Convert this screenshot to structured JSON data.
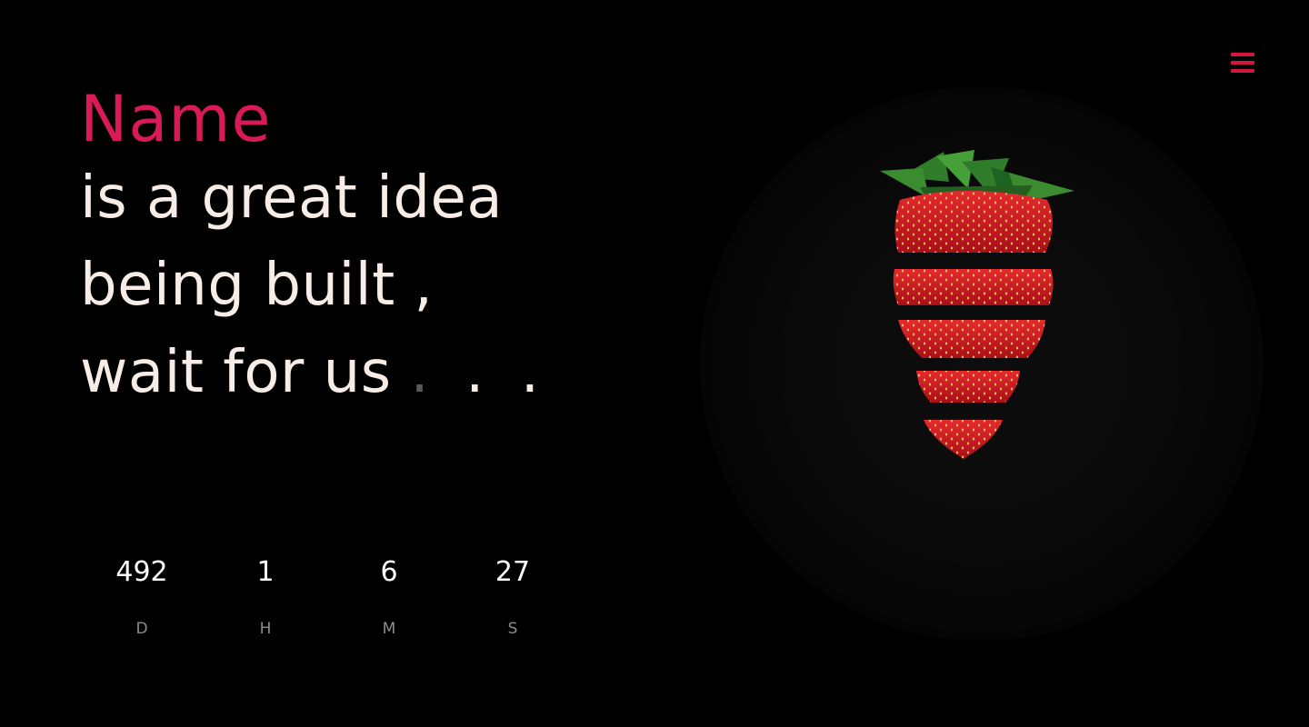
{
  "header": {
    "menu_icon": "hamburger-menu-icon",
    "accent_color": "#d1163f"
  },
  "headline": {
    "brand": "Name",
    "line1": "is a great idea",
    "line2": "being built ,",
    "line3_text": "wait for us",
    "ellipsis": [
      ". ",
      ". ",
      "."
    ],
    "brand_color": "#d81b56",
    "text_color": "#f7ece6"
  },
  "countdown": {
    "days": {
      "value": "492",
      "label": "D"
    },
    "hours": {
      "value": "1",
      "label": "H"
    },
    "minutes": {
      "value": "6",
      "label": "M"
    },
    "seconds": {
      "value": "27",
      "label": "S"
    }
  },
  "hero": {
    "image": "sliced-strawberry"
  }
}
